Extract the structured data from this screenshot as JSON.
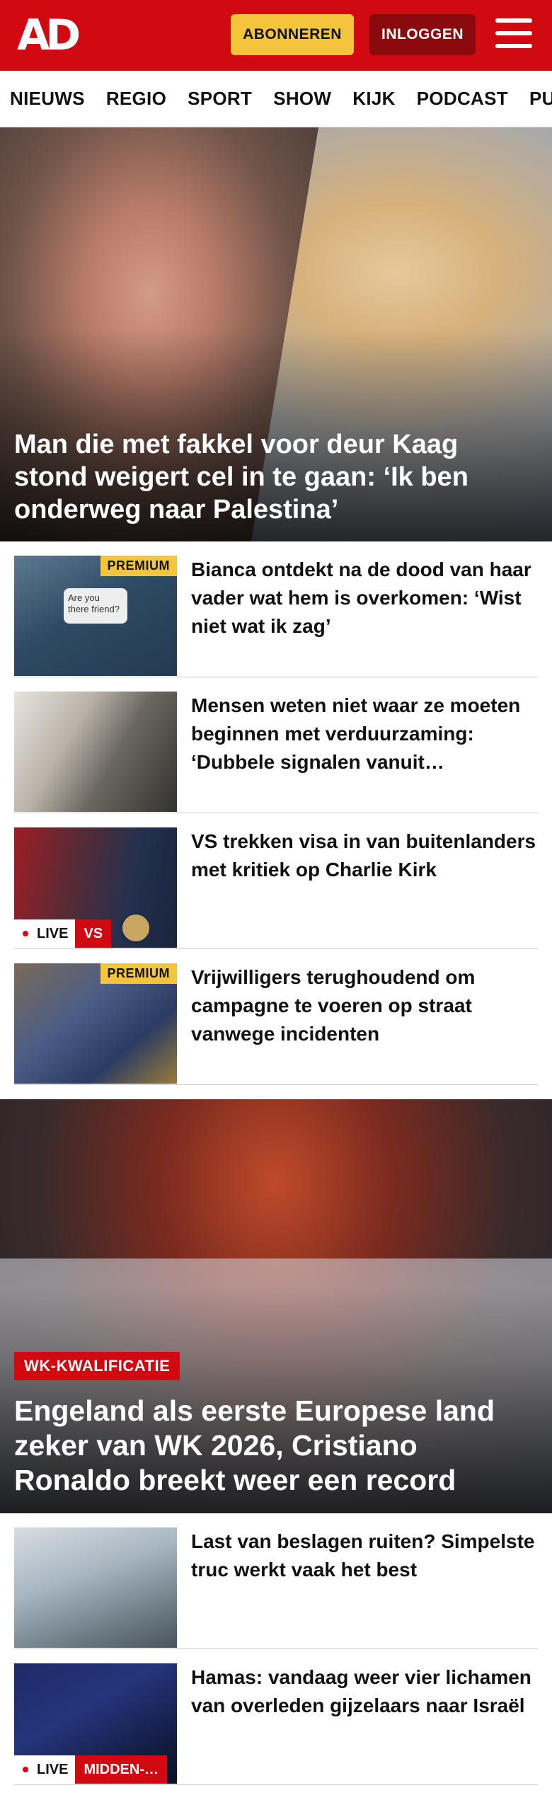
{
  "header": {
    "logo": "AD",
    "subscribe_label": "ABONNEREN",
    "login_label": "INLOGGEN",
    "brand_color": "#d10a11"
  },
  "nav": {
    "items": [
      "NIEUWS",
      "REGIO",
      "SPORT",
      "SHOW",
      "KIJK",
      "PODCAST",
      "PUZZ"
    ]
  },
  "hero": {
    "title": "Man die met fakkel voor deur Kaag stond weigert cel in te gaan: ‘Ik ben onderweg naar Palestina’"
  },
  "articles": [
    {
      "headline": "Bianca ontdekt na de dood van haar vader wat hem is overkomen: ‘Wist niet wat ik zag’",
      "badge": "PREMIUM",
      "thumb_text": "Are you there friend?"
    },
    {
      "headline": "Mensen weten niet waar ze moeten beginnen met verduurza­ming: ‘Dubbele signalen vanuit…"
    },
    {
      "headline": "VS trekken visa in van buitenlan­ders met kritiek op Charlie Kirk",
      "live_label": "LIVE",
      "live_tag": "VS"
    },
    {
      "headline": "Vrijwilligers terughoudend om campagne te voeren op straat vanwege incidenten",
      "badge": "PREMIUM"
    }
  ],
  "sport_hero": {
    "tag": "WK-KWALIFICATIE",
    "title": "Engeland als eerste Europese land zeker van WK 2026, Cristiano Ronaldo breekt weer een record"
  },
  "articles2": [
    {
      "headline": "Last van beslagen ruiten? Simpelste truc werkt vaak het best"
    },
    {
      "headline": "Hamas: vandaag weer vier lichamen van overleden gijzelaars naar Israël",
      "live_label": "LIVE",
      "live_tag": "MIDDEN-…"
    }
  ]
}
